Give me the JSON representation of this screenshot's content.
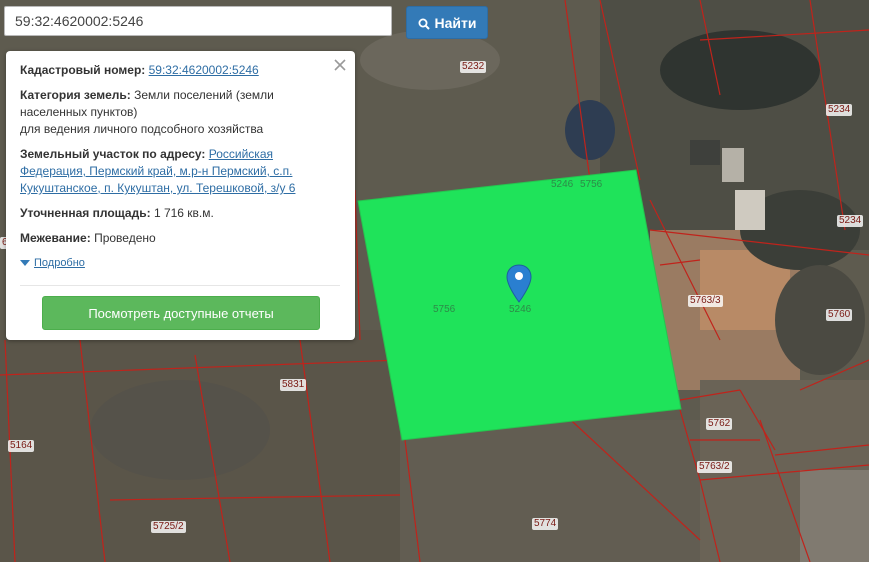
{
  "search": {
    "value": "59:32:4620002:5246",
    "button_label": "Найти"
  },
  "popup": {
    "cadastral_label": "Кадастровый номер:",
    "cadastral_value": "59:32:4620002:5246",
    "category_label": "Категория земель:",
    "category_value_1": "Земли поселений (земли",
    "category_value_2": "населенных пунктов)",
    "category_value_3": "для ведения личного подсобного хозяйства",
    "address_label": "Земельный участок по адресу:",
    "address_value_1": "Российская",
    "address_value_2": "Федерация, Пермский край, м.р-н Пермский, с.п.",
    "address_value_3": "Кукуштанское, п. Кукуштан, ул. Терешковой, з/у 6",
    "area_label": "Уточненная площадь:",
    "area_value": "1 716 кв.м.",
    "survey_label": "Межевание:",
    "survey_value": "Проведено",
    "details_label": "Подробно",
    "report_button_label": "Посмотреть доступные отчеты"
  },
  "map": {
    "selected_parcel_color": "#1fe35a",
    "boundary_color": "#c0231b",
    "marker_color": "#2a7fd0",
    "parcel_labels": [
      {
        "id": "5232",
        "text": "5232"
      },
      {
        "id": "5234a",
        "text": "5234"
      },
      {
        "id": "5234b",
        "text": "5234"
      },
      {
        "id": "5246a",
        "text": "5246"
      },
      {
        "id": "5756a",
        "text": "5756"
      },
      {
        "id": "5756b",
        "text": "5756"
      },
      {
        "id": "5246b",
        "text": "5246"
      },
      {
        "id": "5763_3",
        "text": "5763/3"
      },
      {
        "id": "5760",
        "text": "5760"
      },
      {
        "id": "5831",
        "text": "5831"
      },
      {
        "id": "5762",
        "text": "5762"
      },
      {
        "id": "5164",
        "text": "5164"
      },
      {
        "id": "5763_2",
        "text": "5763/2"
      },
      {
        "id": "5774",
        "text": "5774"
      },
      {
        "id": "5725_2",
        "text": "5725/2"
      },
      {
        "id": "edge6",
        "text": "6"
      }
    ]
  }
}
